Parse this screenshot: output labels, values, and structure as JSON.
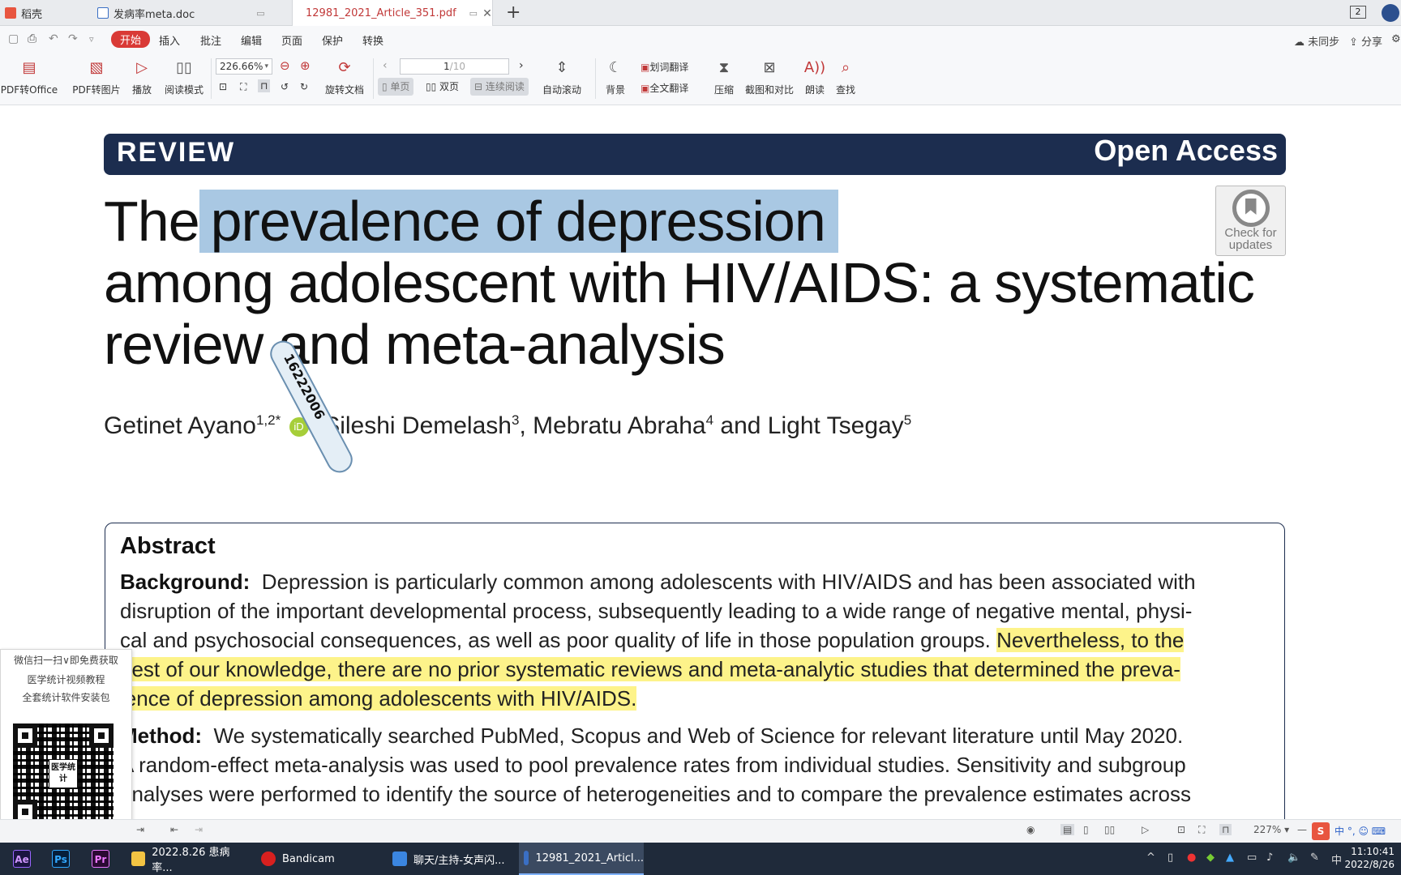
{
  "tabs": [
    {
      "label": "稻壳"
    },
    {
      "label": "发病率meta.doc"
    },
    {
      "label": "12981_2021_Article_351.pdf"
    }
  ],
  "tab_close": "✕",
  "tab_new": "+",
  "window_badge": "2",
  "menu": {
    "items": [
      "开始",
      "插入",
      "批注",
      "编辑",
      "页面",
      "保护",
      "转换"
    ],
    "sync": "未同步",
    "share": "分享"
  },
  "ribbon": {
    "pdf_to_office": "PDF转Office",
    "pdf_to_image": "PDF转图片",
    "play": "播放",
    "read_mode": "阅读模式",
    "zoom": "226.66%",
    "rotate_doc": "旋转文档",
    "page_current": "1",
    "page_total": "/10",
    "single": "单页",
    "double": "双页",
    "continuous": "连续阅读",
    "auto_scroll": "自动滚动",
    "background": "背景",
    "word_translate": "划词翻译",
    "full_translate": "全文翻译",
    "compress": "压缩",
    "screenshot_compare": "截图和对比",
    "read_aloud": "朗读",
    "find": "查找"
  },
  "document": {
    "banner_left": "REVIEW",
    "banner_right": "Open Access",
    "badge_line1": "Check for",
    "badge_line2": "updates",
    "title_part1": "The",
    "title_highlight": "prevalence of depression",
    "title_line2": "among adolescent with HIV/AIDS: a systematic",
    "title_line3": "review and meta-analysis",
    "author1": "Getinet Ayano",
    "author1_sup": "1,2*",
    "orcid": "iD",
    "author2": ", Sileshi Demelash",
    "author2_sup": "3",
    "author3": ", Mebratu Abraha",
    "author3_sup": "4",
    "author4": " and Light Tsegay",
    "author4_sup": "5",
    "abstract_heading": "Abstract",
    "background_label": "Background:",
    "bg_line1": "Depression is particularly common among adolescents with HIV/AIDS and has been associated with",
    "bg_line2": "disruption of the important developmental process, subsequently leading to a wide range of negative mental, physi-",
    "bg_line3_plain": "cal and psychosocial consequences, as well as poor quality of life in those population groups.",
    "bg_line3_hl": "Nevertheless, to the",
    "bg_line4_hl": "best of our knowledge, there are no prior systematic reviews and meta-analytic studies that determined the preva-",
    "bg_line5_hl": "lence of depression among adolescents with HIV/AIDS.",
    "method_label": "Method:",
    "m_line1": "We systematically searched PubMed, Scopus and Web of Science for relevant literature until May 2020.",
    "m_line2": "A random-effect meta-analysis was used to pool prevalence rates from individual studies. Sensitivity and subgroup",
    "m_line3": "analyses were performed to identify the source of heterogeneities and to compare the prevalence estimates across"
  },
  "pen_text": "16222006",
  "qr_panel": {
    "line1": "微信扫一扫∨即免费获取",
    "line2": "医学统计视频教程",
    "line3": "全套统计软件安装包",
    "logo": "医学统计"
  },
  "status": {
    "zoom": "227%"
  },
  "taskbar": {
    "apps": [
      "Ae",
      "Ps",
      "Pr"
    ],
    "items": [
      "2022.8.26 患病率...",
      "Bandicam",
      "聊天/主持-女声闪...",
      "12981_2021_Articl..."
    ],
    "ime": "中",
    "time": "11:10:41",
    "date": "2022/8/26"
  },
  "colors": {
    "accent": "#d93a36",
    "banner": "#1c2d4f",
    "highlight_blue": "#a9c8e3",
    "highlight_yellow": "#fdf38a"
  }
}
